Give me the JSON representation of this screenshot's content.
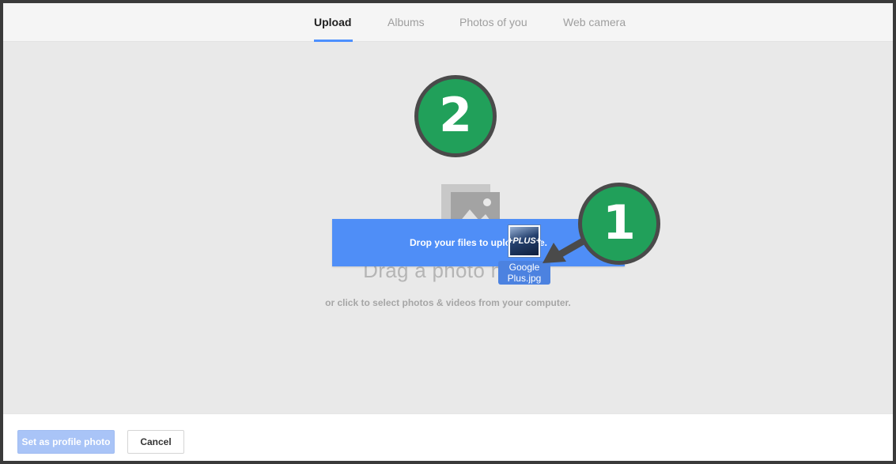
{
  "tabs": {
    "upload": "Upload",
    "albums": "Albums",
    "photos_of_you": "Photos of you",
    "web_camera": "Web camera"
  },
  "dropzone": {
    "drag_text": "Drag a photo here",
    "sub_text": "or click to select photos & videos from your computer.",
    "banner_text": "Drop your files to upload here.",
    "icon": "image-placeholder-icon"
  },
  "dragged_file": {
    "name": "Google Plus.jpg",
    "thumb_text": "+PLUS+"
  },
  "annotations": {
    "step_1": "1",
    "step_2": "2"
  },
  "footer": {
    "set_profile_label": "Set as profile photo",
    "cancel_label": "Cancel"
  },
  "colors": {
    "accent": "#4d90fe",
    "banner": "#4f8ef7",
    "badge": "#21a05a",
    "disabled_primary": "#a9c4f7"
  }
}
